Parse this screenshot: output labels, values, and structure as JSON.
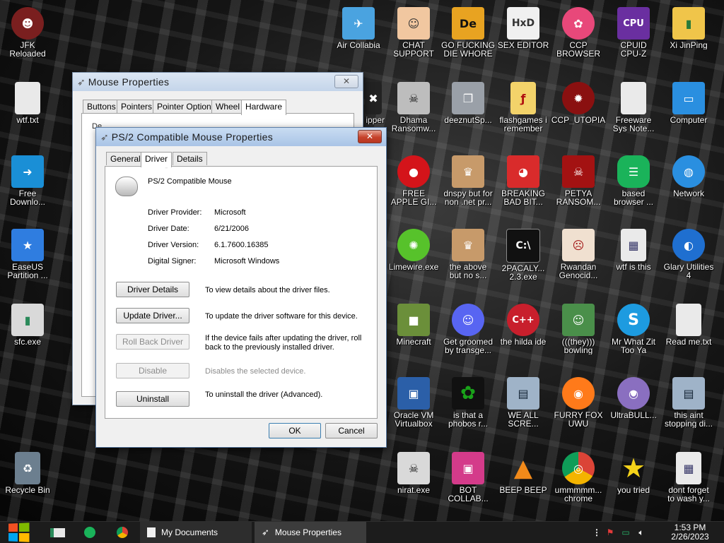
{
  "desktop": {
    "icons": [
      {
        "label": "JFK\nReloaded",
        "color": "#7a1f1f",
        "glyph": "☻"
      },
      {
        "label": "wtf.txt",
        "color": "#e9e9e9",
        "glyph": ""
      },
      {
        "label": "Free\nDownlo...",
        "color": "#1a8fd6",
        "glyph": "➜"
      },
      {
        "label": "EaseUS\nPartition ...",
        "color": "#2f7de0",
        "glyph": "★"
      },
      {
        "label": "sfc.exe",
        "color": "#d9d9d9",
        "glyph": "▮"
      },
      {
        "label": "Recycle Bin",
        "color": "#6c7f8f",
        "glyph": "♻"
      },
      {
        "label": "Air Collabia",
        "color": "#4aa3e0",
        "glyph": "✈"
      },
      {
        "label": "ipper",
        "color": "#222222",
        "glyph": "✖"
      },
      {
        "label": "CHAT\nSUPPORT",
        "color": "#f1c7a0",
        "glyph": "☺"
      },
      {
        "label": "Dhama\nRansomw...",
        "color": "#bdbdbd",
        "glyph": "☠"
      },
      {
        "label": "FREE\nAPPLE GI...",
        "color": "#d4141a",
        "glyph": "●"
      },
      {
        "label": "Limewire.exe",
        "color": "#57c22b",
        "glyph": "✺"
      },
      {
        "label": "Minecraft",
        "color": "#6b8f3a",
        "glyph": "■"
      },
      {
        "label": "Oracle VM\nVirtualbox",
        "color": "#2b5fa8",
        "glyph": "▣"
      },
      {
        "label": "nirat.exe",
        "color": "#d9d9d9",
        "glyph": "☠"
      },
      {
        "label": "GO FUCKING\nDIE WHORE",
        "color": "#e8a321",
        "glyph": "De"
      },
      {
        "label": "deeznutSp...",
        "color": "#9aa0a8",
        "glyph": "❐"
      },
      {
        "label": "dnspy but for\nnon .net pr...",
        "color": "#c79a6a",
        "glyph": "♛"
      },
      {
        "label": "the above\nbut no s...",
        "color": "#c79a6a",
        "glyph": "♛"
      },
      {
        "label": "Get groomed\nby transge...",
        "color": "#5865f2",
        "glyph": "☺"
      },
      {
        "label": "is that a\nphobos r...",
        "color": "#1aa21a",
        "glyph": "✿"
      },
      {
        "label": "BOT\nCOLLAB...",
        "color": "#d43b8a",
        "glyph": "▣"
      },
      {
        "label": "SEX EDITOR",
        "color": "#f0f0f0",
        "glyph": "HxD"
      },
      {
        "label": "flashgames i\nremember",
        "color": "#f3d36a",
        "glyph": "ƒ"
      },
      {
        "label": "BREAKING\nBAD BIT...",
        "color": "#d92b2b",
        "glyph": "◕"
      },
      {
        "label": "2PACALY...\n2.3.exe",
        "color": "#111111",
        "glyph": "C:\\"
      },
      {
        "label": "the hilda ide",
        "color": "#c81f2c",
        "glyph": "C++"
      },
      {
        "label": "WE ALL\nSCRE...",
        "color": "#9fb3c8",
        "glyph": "▤"
      },
      {
        "label": "BEEP BEEP",
        "color": "#f28a1a",
        "glyph": "▲"
      },
      {
        "label": "CCP\nBROWSER",
        "color": "#e8487a",
        "glyph": "✿"
      },
      {
        "label": "CCP_UTOPIA",
        "color": "#8a1010",
        "glyph": "✹"
      },
      {
        "label": "PETYA\nRANSOM...",
        "color": "#a31212",
        "glyph": "☠"
      },
      {
        "label": "Rwandan\nGenocid...",
        "color": "#f0e0d0",
        "glyph": "☹"
      },
      {
        "label": "(((they)))\nbowling",
        "color": "#4a8f4a",
        "glyph": "☺"
      },
      {
        "label": "FURRY FOX\nUWU",
        "color": "#ff7a1a",
        "glyph": "◉"
      },
      {
        "label": "ummmmm...\nchrome",
        "color": "#1f9d55",
        "glyph": "◎"
      },
      {
        "label": "CPUID\nCPU-Z",
        "color": "#6a2fa0",
        "glyph": "CPU"
      },
      {
        "label": "Freeware\nSys Note...",
        "color": "#eaeaea",
        "glyph": ""
      },
      {
        "label": "based\nbrowser ...",
        "color": "#1ab35a",
        "glyph": "☰"
      },
      {
        "label": "wtf is this",
        "color": "#eaeaea",
        "glyph": "▦"
      },
      {
        "label": "Mr What Zit\nToo Ya",
        "color": "#1d9be0",
        "glyph": "S"
      },
      {
        "label": "UltraBULL...",
        "color": "#8a6fc0",
        "glyph": "◎"
      },
      {
        "label": "you tried",
        "color": "#f5d31a",
        "glyph": "★"
      },
      {
        "label": "Xi JinPing",
        "color": "#f0c54a",
        "glyph": "▮"
      },
      {
        "label": "Computer",
        "color": "#2a8fe0",
        "glyph": "▭"
      },
      {
        "label": "Network",
        "color": "#2a8fe0",
        "glyph": "◍"
      },
      {
        "label": "Glary Utilities\n4",
        "color": "#1f6fd0",
        "glyph": "◐"
      },
      {
        "label": "Read me.txt",
        "color": "#eaeaea",
        "glyph": ""
      },
      {
        "label": "this aint\nstopping di...",
        "color": "#9fb3c8",
        "glyph": "▤"
      },
      {
        "label": "dont forget\nto wash y...",
        "color": "#eaeaea",
        "glyph": "▦"
      }
    ]
  },
  "mouse_properties": {
    "title": "Mouse Properties",
    "tabs": [
      "Buttons",
      "Pointers",
      "Pointer Options",
      "Wheel",
      "Hardware"
    ],
    "active_tab": "Hardware",
    "partial_label": "De"
  },
  "driver_dialog": {
    "title": "PS/2 Compatible Mouse Properties",
    "tabs": [
      "General",
      "Driver",
      "Details"
    ],
    "active_tab": "Driver",
    "device_name": "PS/2 Compatible Mouse",
    "fields": [
      {
        "label": "Driver Provider:",
        "value": "Microsoft"
      },
      {
        "label": "Driver Date:",
        "value": "6/21/2006"
      },
      {
        "label": "Driver Version:",
        "value": "6.1.7600.16385"
      },
      {
        "label": "Digital Signer:",
        "value": "Microsoft Windows"
      }
    ],
    "actions": [
      {
        "button": "Driver Details",
        "desc": "To view details about the driver files.",
        "enabled": true
      },
      {
        "button": "Update Driver...",
        "desc": "To update the driver software for this device.",
        "enabled": true
      },
      {
        "button": "Roll Back Driver",
        "desc": "If the device fails after updating the driver, roll back to the previously installed driver.",
        "enabled": false
      },
      {
        "button": "Disable",
        "desc": "Disables the selected device.",
        "enabled": false
      },
      {
        "button": "Uninstall",
        "desc": "To uninstall the driver (Advanced).",
        "enabled": true
      }
    ],
    "ok_label": "OK",
    "cancel_label": "Cancel",
    "close_glyph": "✕"
  },
  "taskbar": {
    "tasks": [
      {
        "label": "My Documents"
      },
      {
        "label": "Mouse Properties"
      }
    ],
    "clock_time": "1:53 PM",
    "clock_date": "2/26/2023"
  },
  "colors": {
    "titlebar_active": "#c4d5ea",
    "close_red": "#c6422b",
    "taskbar": "#1c1c1c",
    "start_blue": "#1e90ff"
  }
}
